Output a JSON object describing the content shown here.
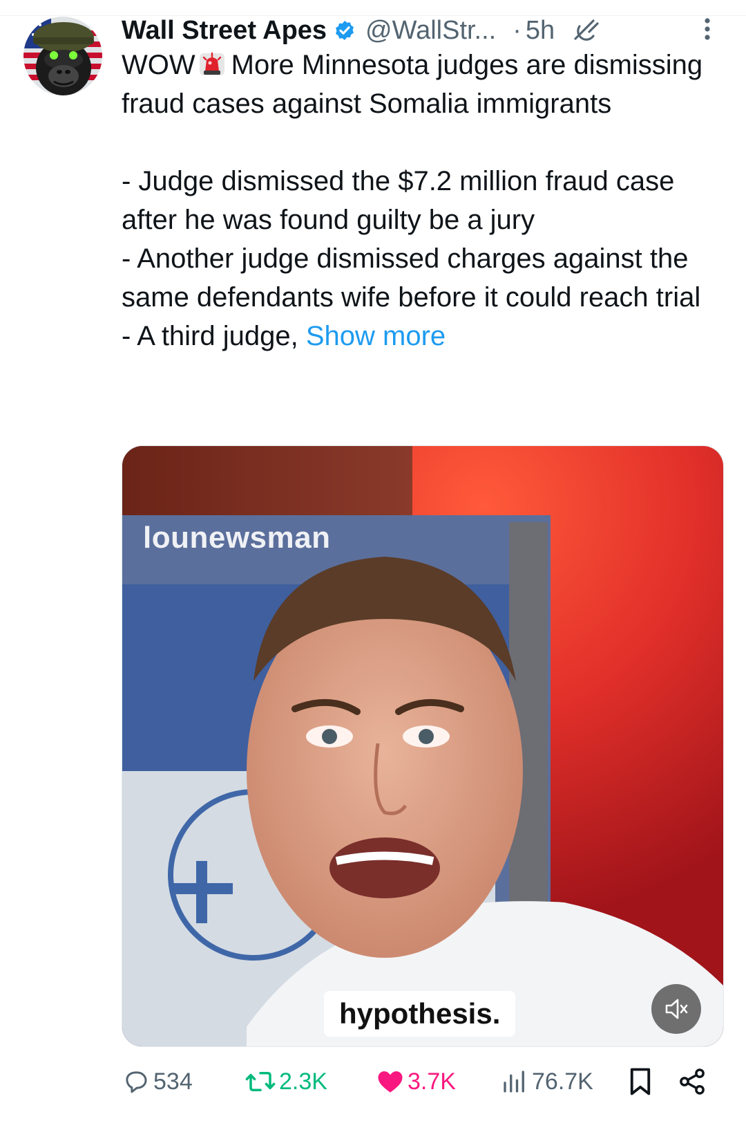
{
  "post": {
    "author": {
      "display_name": "Wall Street Apes",
      "handle": "@WallStr...",
      "verified": true
    },
    "separator": "·",
    "time": "5h",
    "text": {
      "line1_a": "WOW",
      "line1_b": "More Minnesota judges are dismissing fraud cases against Somalia immigrants",
      "bullet1": "- Judge dismissed the $7.2 million fraud case after he was found guilty be a jury",
      "bullet2": "- Another judge dismissed charges against the same defendants wife before it could reach trial",
      "bullet3": "- A third judge,",
      "show_more": "Show more"
    },
    "media": {
      "watermark": "lounewsman",
      "caption": "hypothesis."
    },
    "stats": {
      "replies": "534",
      "reposts": "2.3K",
      "likes": "3.7K",
      "views": "76.7K"
    }
  },
  "icons": {
    "verified": "verified-badge-icon",
    "grok": "grok-icon",
    "more": "more-vertical-icon",
    "alarm": "police-light-emoji",
    "mute": "speaker-muted-icon",
    "reply": "reply-icon",
    "repost": "repost-icon",
    "like": "heart-icon",
    "views": "views-icon",
    "bookmark": "bookmark-icon",
    "share": "share-icon"
  },
  "colors": {
    "accent": "#1d9bf0",
    "muted_text": "#536471",
    "repost_active": "#00ba7c",
    "like_active": "#f91880"
  }
}
